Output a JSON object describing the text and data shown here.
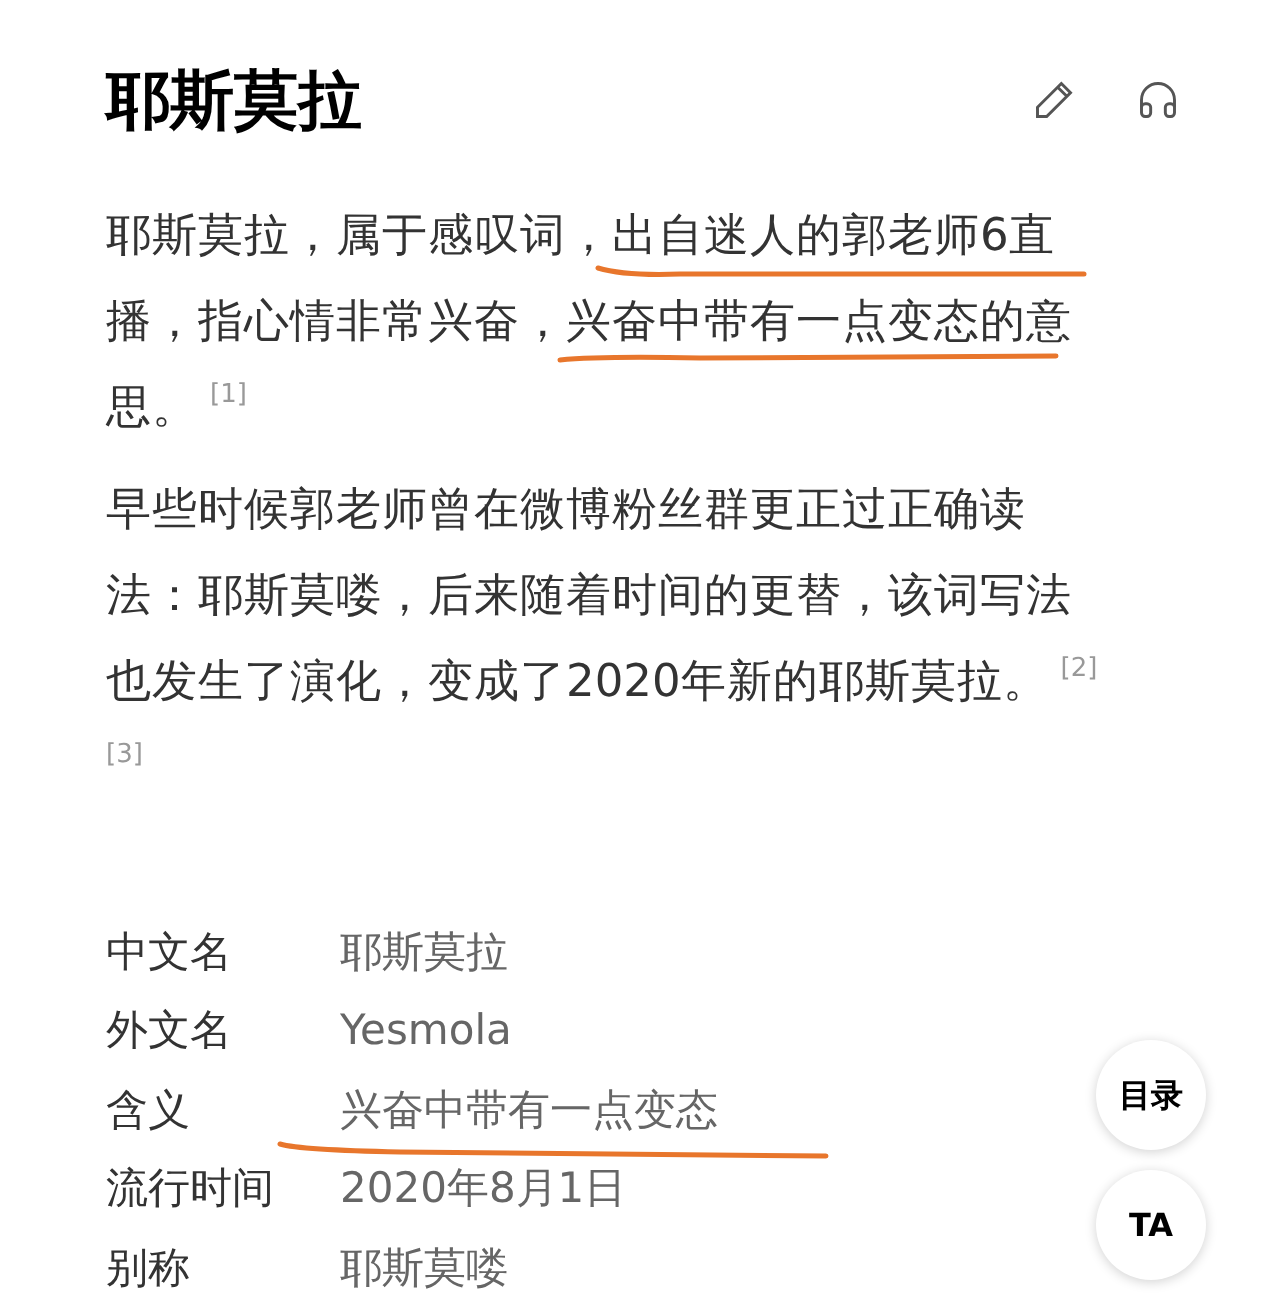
{
  "header": {
    "title": "耶斯莫拉"
  },
  "paragraphs": [
    {
      "lines": [
        {
          "text": "耶斯莫拉，属于感叹词，出自迷人的郭老师6直"
        },
        {
          "text": "播，指心情非常兴奋，兴奋中带有一点变态的意"
        },
        {
          "text": "思。",
          "citations": [
            "[1]"
          ]
        }
      ]
    },
    {
      "lines": [
        {
          "text": "早些时候郭老师曾在微博粉丝群更正过正确读"
        },
        {
          "text": "法：耶斯莫喽，后来随着时间的更替，该词写法"
        },
        {
          "text": "也发生了演化，变成了2020年新的耶斯莫拉。",
          "citations": [
            "[2]"
          ]
        },
        {
          "citations": [
            "[3]"
          ]
        }
      ]
    }
  ],
  "info": [
    {
      "label": "中文名",
      "value": "耶斯莫拉"
    },
    {
      "label": "外文名",
      "value": "Yesmola"
    },
    {
      "label": "含义",
      "value": "兴奋中带有一点变态"
    },
    {
      "label": "流行时间",
      "value": "2020年8月1日"
    },
    {
      "label": "别称",
      "value": "耶斯莫喽"
    }
  ],
  "floating_buttons": [
    {
      "label": "目录"
    },
    {
      "label": "TA"
    }
  ]
}
